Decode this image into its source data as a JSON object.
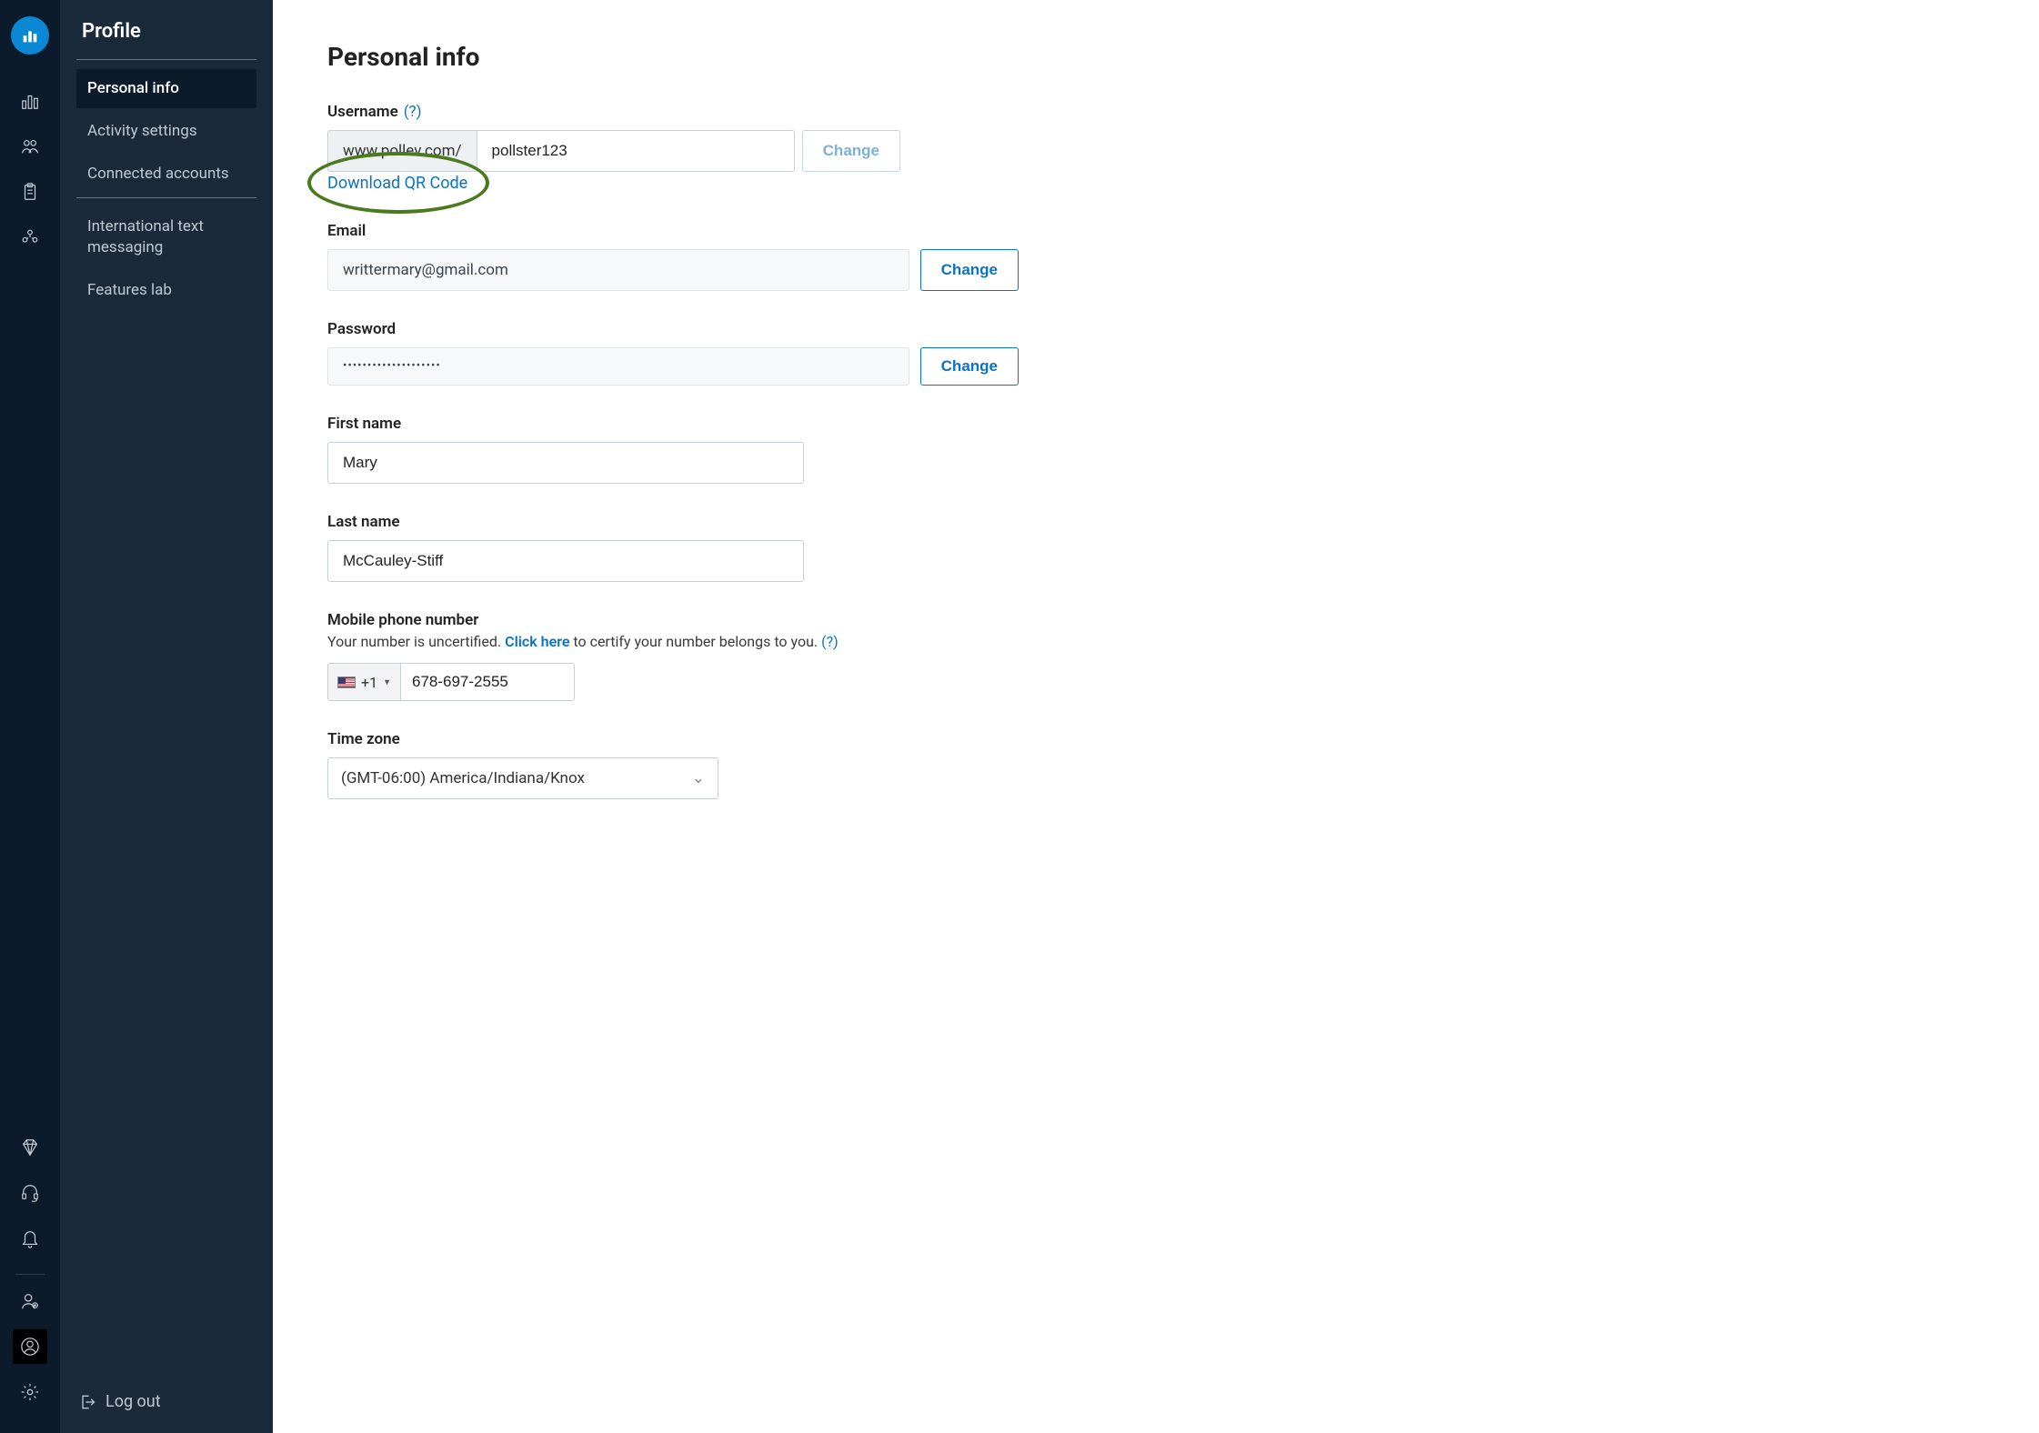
{
  "sidebar": {
    "title": "Profile",
    "items_top": [
      {
        "label": "Personal info",
        "active": true
      },
      {
        "label": "Activity settings",
        "active": false
      },
      {
        "label": "Connected accounts",
        "active": false
      }
    ],
    "items_bottom": [
      {
        "label": "International text messaging"
      },
      {
        "label": "Features lab"
      }
    ],
    "logout_label": "Log out"
  },
  "page": {
    "title": "Personal info",
    "username": {
      "label": "Username",
      "help": "(?)",
      "prefix": "www.pollev.com/",
      "value": "pollster123",
      "change_label": "Change",
      "download_label": "Download QR Code"
    },
    "email": {
      "label": "Email",
      "value": "writtermary@gmail.com",
      "change_label": "Change"
    },
    "password": {
      "label": "Password",
      "value": "••••••••••••••••••••",
      "change_label": "Change"
    },
    "first_name": {
      "label": "First name",
      "value": "Mary"
    },
    "last_name": {
      "label": "Last name",
      "value": "McCauley-Stiff"
    },
    "mobile": {
      "label": "Mobile phone number",
      "helper_pre": "Your number is uncertified. ",
      "helper_link": "Click here",
      "helper_post": " to certify your number belongs to you. ",
      "helper_help": "(?)",
      "country_code": "+1",
      "value": "678-697-2555"
    },
    "timezone": {
      "label": "Time zone",
      "value": "(GMT-06:00) America/Indiana/Knox"
    }
  }
}
